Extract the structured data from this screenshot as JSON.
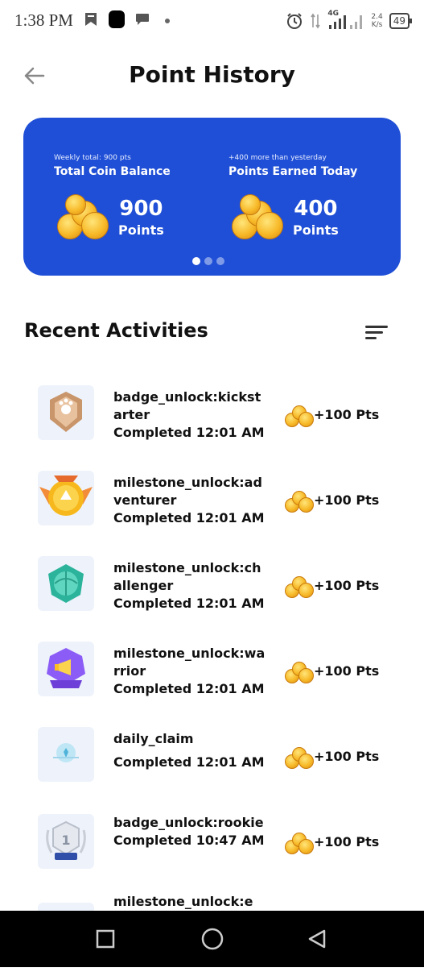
{
  "status": {
    "time": "1:38 PM",
    "network": "4G",
    "speed_value": "2.4",
    "speed_unit": "K/s",
    "battery": "49"
  },
  "header": {
    "title": "Point History",
    "back_icon": "arrow-left-icon"
  },
  "balance_card": {
    "left": {
      "subtitle": "Weekly total: 900 pts",
      "title": "Total Coin Balance",
      "value": "900",
      "unit": "Points"
    },
    "right": {
      "subtitle": "+400 more than yesterday",
      "title": "Points Earned Today",
      "value": "400",
      "unit": "Points"
    },
    "background_color": "#1f4fd6",
    "pages": 3,
    "active_page": 1
  },
  "activities": {
    "title": "Recent Activities",
    "filter_icon": "sort-icon",
    "items": [
      {
        "name": "badge_unlock:kickstarter",
        "status": "Completed 12:01 AM",
        "reward": "+100 Pts",
        "icon": "bronze-badge-icon"
      },
      {
        "name": "milestone_unlock:adventurer",
        "status": "Completed 12:01 AM",
        "reward": "+100 Pts",
        "icon": "gold-medal-icon"
      },
      {
        "name": "milestone_unlock:challenger",
        "status": "Completed 12:01 AM",
        "reward": "+100 Pts",
        "icon": "teal-shield-icon"
      },
      {
        "name": "milestone_unlock:warrior",
        "status": "Completed 12:01 AM",
        "reward": "+100 Pts",
        "icon": "purple-megaphone-badge-icon"
      },
      {
        "name": "daily_claim",
        "status": "Completed 12:01 AM",
        "reward": "+100 Pts",
        "icon": "daily-claim-icon"
      },
      {
        "name": "badge_unlock:rookie",
        "status": "Completed 10:47 AM",
        "reward": "+100 Pts",
        "icon": "silver-badge-icon"
      },
      {
        "name": "milestone_unlock:e",
        "status": "",
        "reward": "",
        "icon": "badge-icon"
      }
    ]
  },
  "navbar": {
    "buttons": [
      "recent-apps-icon",
      "home-icon",
      "back-triangle-icon"
    ]
  }
}
